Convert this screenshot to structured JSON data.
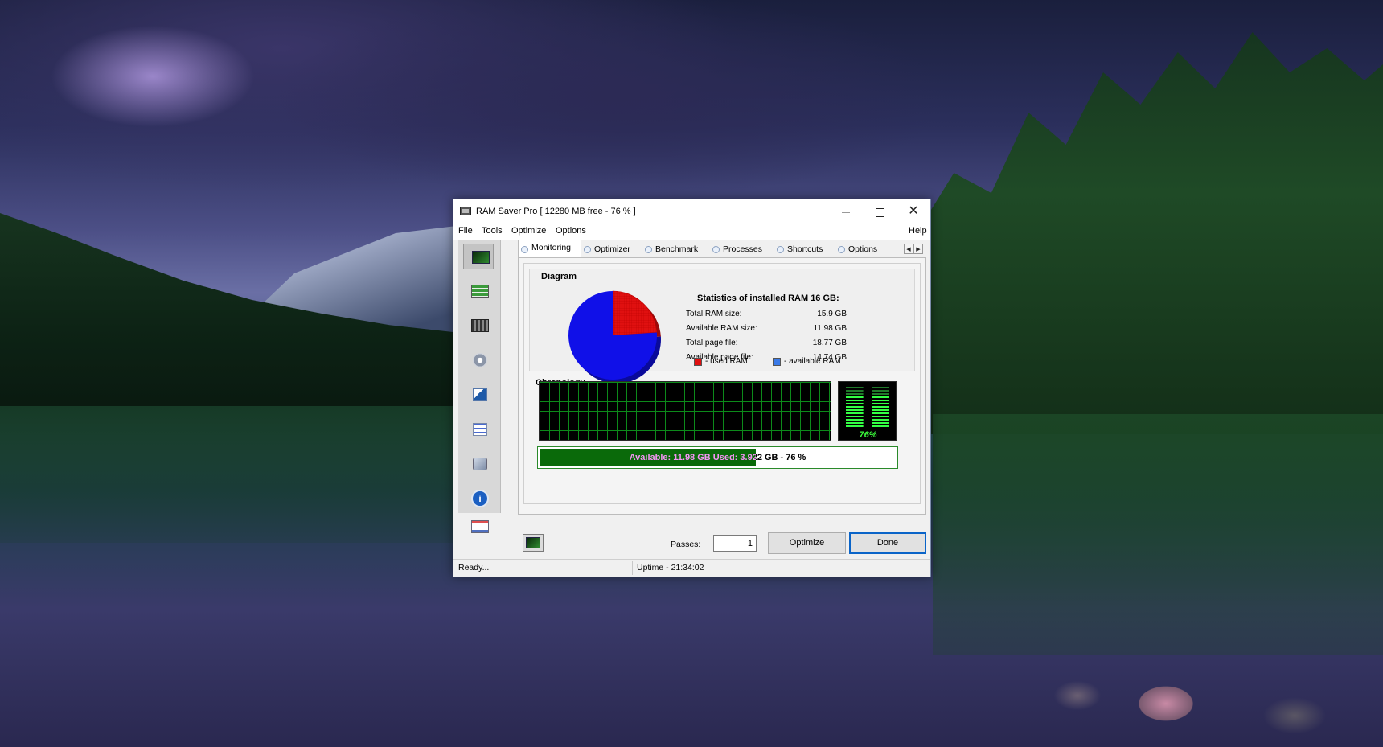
{
  "window": {
    "title": "RAM Saver Pro [ 12280 MB free - 76 % ]",
    "close_glyph": "✕"
  },
  "menu": {
    "file": "File",
    "tools": "Tools",
    "optimize": "Optimize",
    "options": "Options",
    "help": "Help"
  },
  "sidebar": {
    "icons": [
      "monitoring-icon",
      "optimizer-icon",
      "benchmark-icon",
      "processes-icon",
      "shortcuts-icon",
      "tasks-icon",
      "settings-icon",
      "info-icon",
      "mail-icon"
    ],
    "info_glyph": "i"
  },
  "tabs": [
    {
      "label": "Monitoring",
      "active": true
    },
    {
      "label": "Optimizer"
    },
    {
      "label": "Benchmark"
    },
    {
      "label": "Processes"
    },
    {
      "label": "Shortcuts"
    },
    {
      "label": "Options"
    }
  ],
  "tab_scroll": {
    "left": "◀",
    "right": "▶"
  },
  "diagram": {
    "title": "Diagram",
    "stats_title": "Statistics of installed RAM 16 GB:",
    "stats": [
      {
        "label": "Total RAM size:",
        "value": "15.9 GB"
      },
      {
        "label": "Available RAM size:",
        "value": "11.98 GB"
      },
      {
        "label": "Total page file:",
        "value": "18.77 GB"
      },
      {
        "label": "Available page file:",
        "value": "14.74 GB"
      }
    ],
    "legend_used": "- used RAM",
    "legend_available": "- available RAM",
    "colors": {
      "used": "#e01010",
      "available": "#1010e8"
    }
  },
  "chart_data": {
    "type": "pie",
    "categories": [
      "used RAM",
      "available RAM"
    ],
    "values": [
      24,
      76
    ]
  },
  "chronology": {
    "title": "Chronology",
    "meter_label": "76%",
    "meter_percent": 76
  },
  "usage": {
    "text": "Available: 11.98 GB  Used: 3.922 GB - 76 %",
    "fill_percent": 61
  },
  "controls": {
    "passes_label": "Passes:",
    "passes_value": "1",
    "optimize_label": "Optimize",
    "done_label": "Done"
  },
  "status": {
    "left": "Ready...",
    "uptime": "Uptime - 21:34:02"
  }
}
